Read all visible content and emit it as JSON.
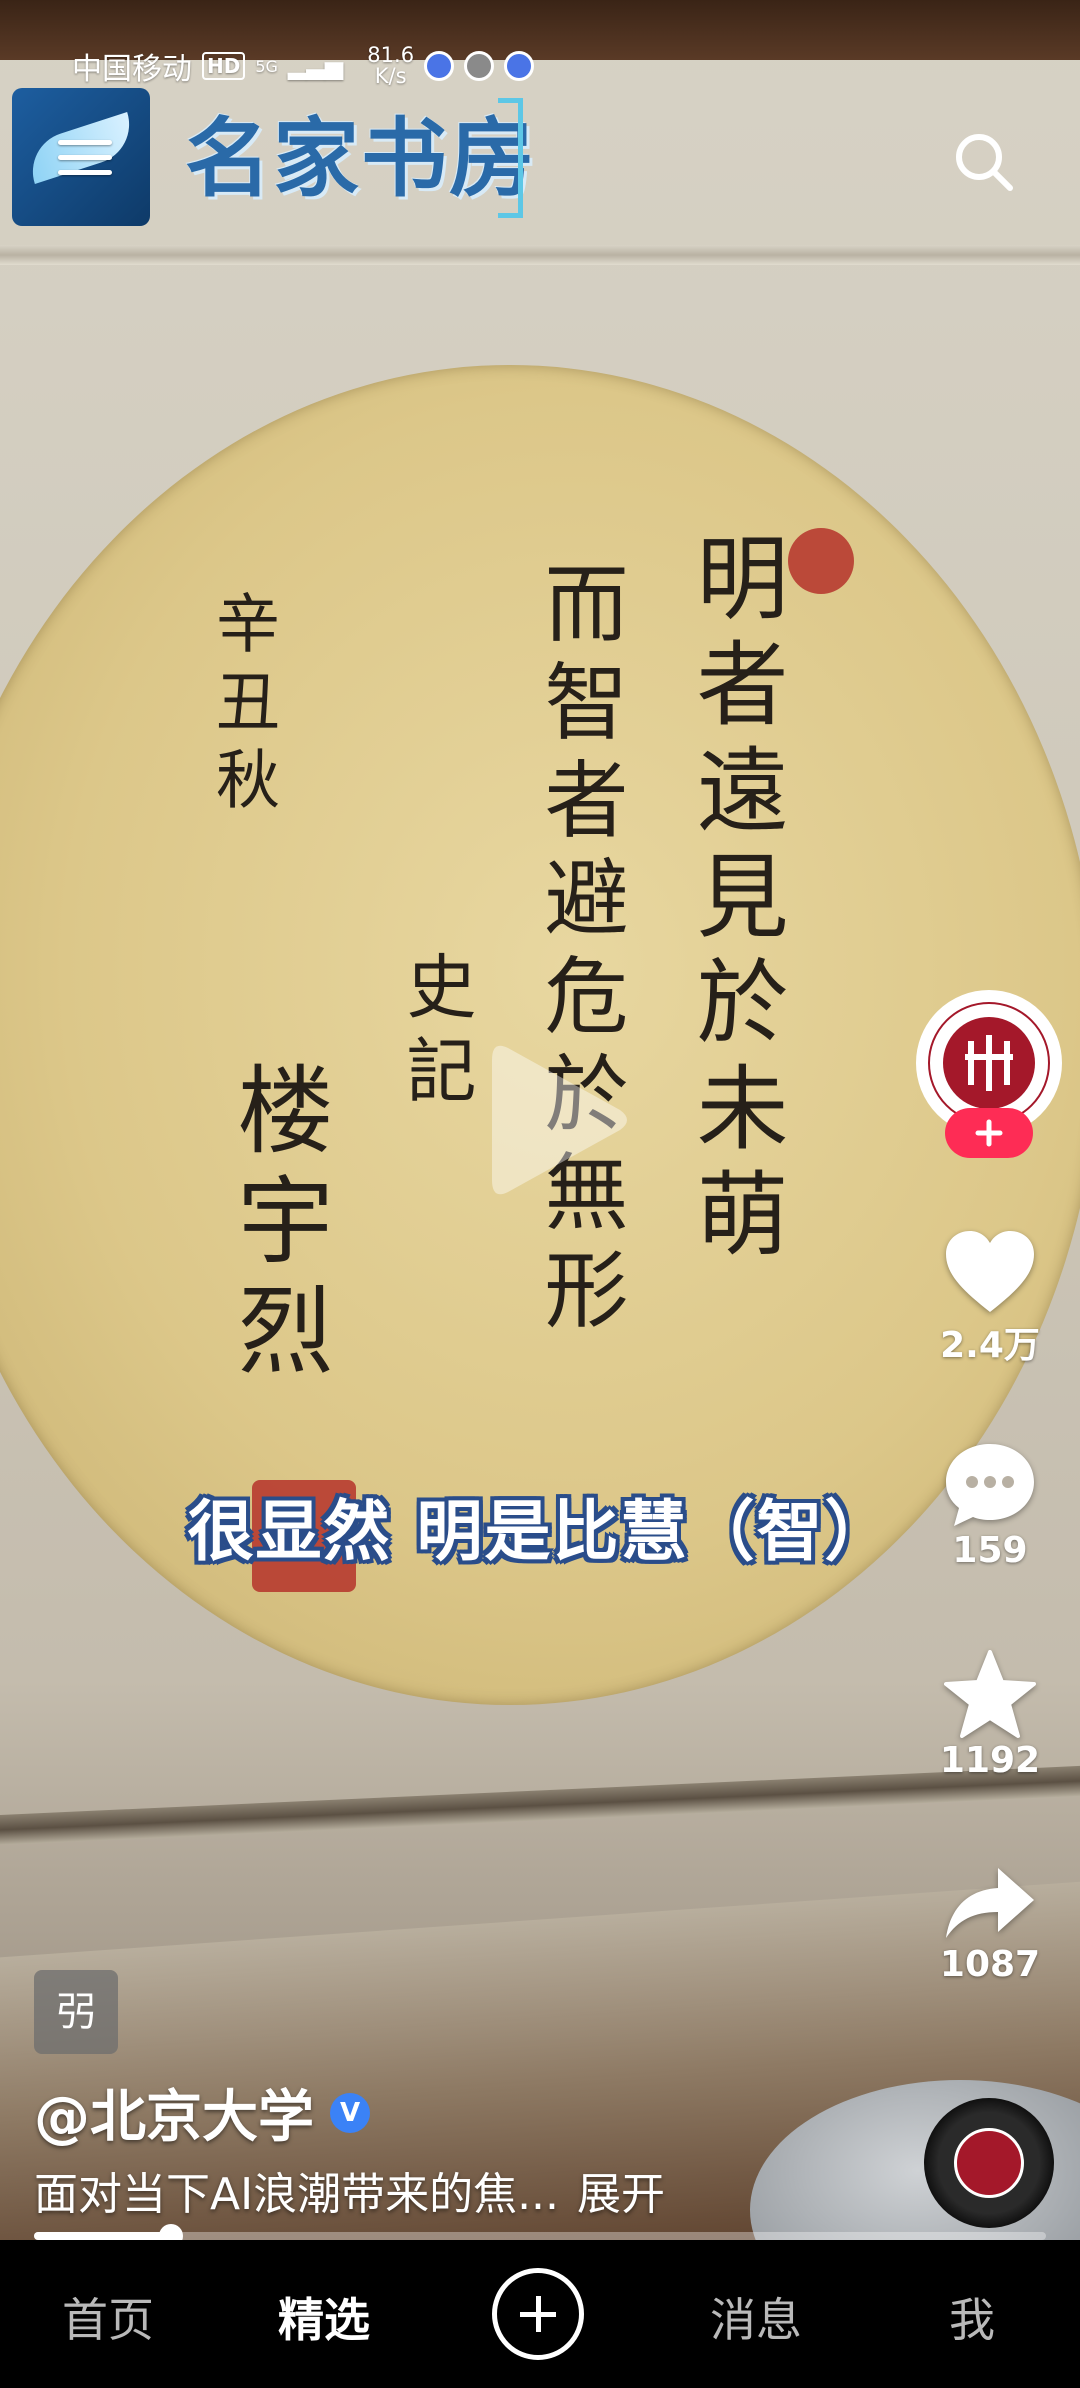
{
  "status_bar": {
    "carrier": "中国移动",
    "hd": "HD",
    "network": "5G",
    "speed_value": "81.6",
    "speed_unit": "K/s"
  },
  "header": {
    "brand_title": "名家书房",
    "menu_icon": "menu-icon",
    "search_icon": "search-icon"
  },
  "video": {
    "calligraphy": {
      "col1": "明者遠見於未萌",
      "col2": "而智者避危於無形",
      "col3": "史記",
      "col4": "辛丑秋",
      "col5": "楼宇烈"
    },
    "subtitle": "很显然 明是比慧（智）"
  },
  "actions": {
    "likes": "2.4万",
    "comments": "159",
    "favorites": "1192",
    "shares": "1087"
  },
  "post": {
    "tag": "弜",
    "author": "@北京大学",
    "verified_mark": "V",
    "description": "面对当下AI浪潮带来的焦...",
    "expand": "展开",
    "progress": 0.135
  },
  "nav": {
    "home": "首页",
    "featured": "精选",
    "messages": "消息",
    "me": "我"
  },
  "colors": {
    "follow_accent": "#fe2c55",
    "verified": "#3b82f6",
    "subtitle_outline": "#2a4d8a"
  }
}
